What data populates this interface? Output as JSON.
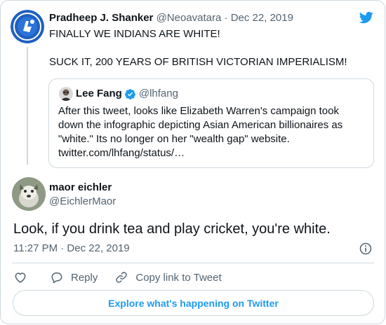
{
  "colors": {
    "twitter_blue": "#1d9bf0",
    "text_primary": "#0f1419",
    "text_secondary": "#536471",
    "border": "#cfd9de"
  },
  "parent_tweet": {
    "avatar_icon": "avatar-blue-emblem",
    "name": "Pradheep J. Shanker",
    "handle": "@Neoavatara",
    "separator": "·",
    "date": "Dec 22, 2019",
    "text_line1": "FINALLY WE INDIANS ARE WHITE!",
    "text_line2": "SUCK IT, 200 YEARS OF BRITISH VICTORIAN IMPERIALISM!"
  },
  "quoted_tweet": {
    "avatar_icon": "avatar-lee-fang",
    "name": "Lee Fang",
    "verified_icon": "verified-badge-icon",
    "handle": "@lhfang",
    "text": "After this tweet, looks like Elizabeth Warren's campaign took down the infographic depicting Asian American billionaires as \"white.\" Its no longer on her \"wealth gap\" website. twitter.com/lhfang/status/…"
  },
  "main_tweet": {
    "avatar_icon": "avatar-maor-eichler",
    "name": "maor eichler",
    "handle": "@EichlerMaor",
    "text": "Look, if you drink tea and play cricket, you're white.",
    "timestamp": "11:27 PM · Dec 22, 2019"
  },
  "actions": {
    "like_icon": "heart-icon",
    "reply_label": "Reply",
    "copy_link_label": "Copy link to Tweet"
  },
  "footer": {
    "explore_label": "Explore what's happening on Twitter"
  }
}
